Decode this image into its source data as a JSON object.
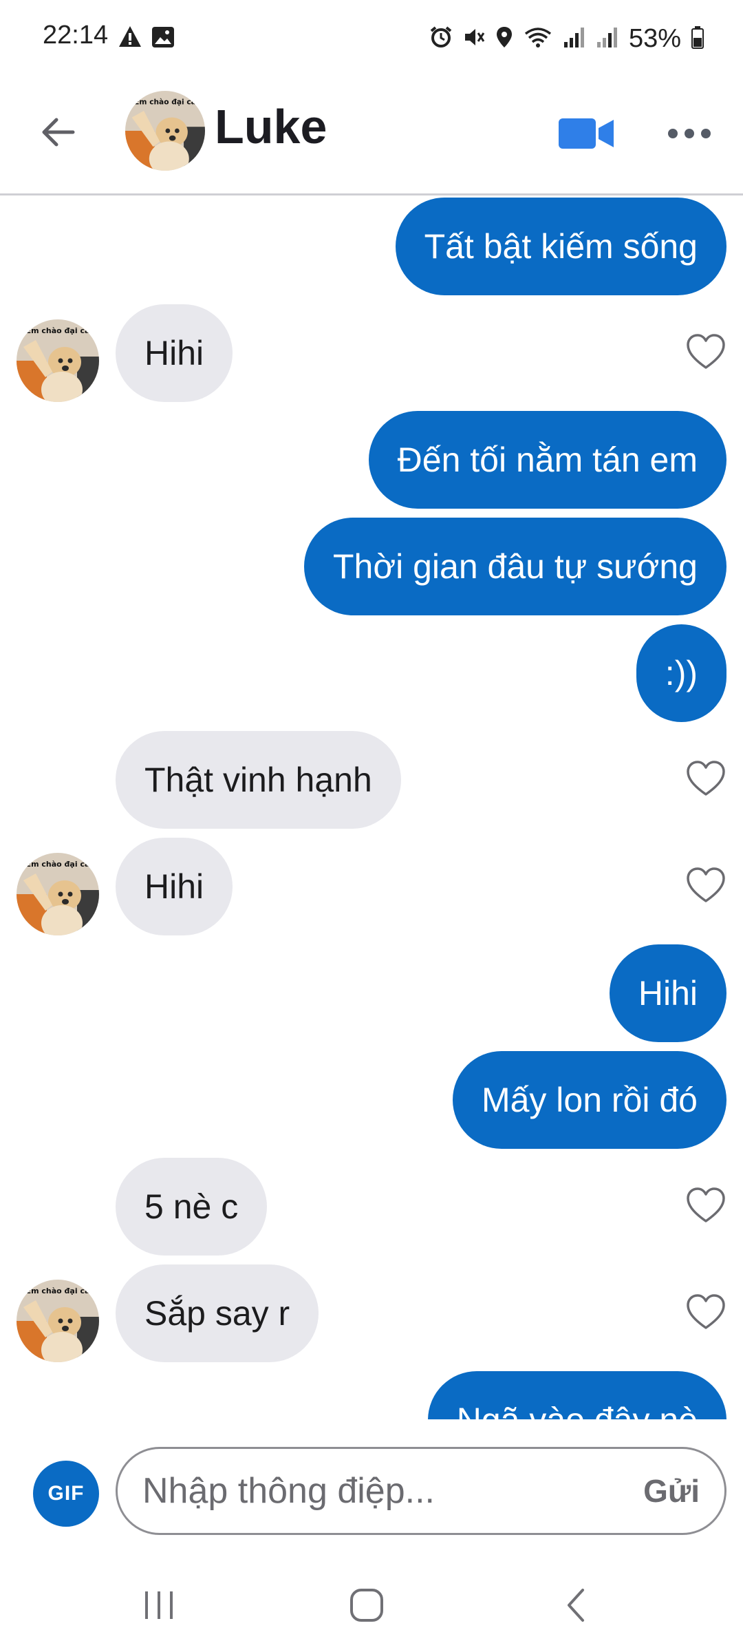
{
  "status_bar": {
    "time": "22:14",
    "battery": "53%",
    "icons": [
      "warning-icon",
      "gallery-icon",
      "alarm-icon",
      "mute-icon",
      "location-icon",
      "wifi-icon",
      "signal-icon",
      "signal-icon",
      "battery-icon"
    ]
  },
  "header": {
    "contact_name": "Luke",
    "avatar_caption": "Em chào đại ca",
    "back_icon": "arrow-left-icon",
    "video_icon": "video-camera-icon",
    "more_icon": "more-horizontal-icon"
  },
  "colors": {
    "accent": "#0a6bc4",
    "incoming_bubble": "#e8e8ed",
    "outgoing_text": "#ffffff",
    "incoming_text": "#1c1c1e"
  },
  "messages": [
    {
      "direction": "out",
      "text": "Tất bật kiếm sống"
    },
    {
      "direction": "in",
      "text": "Hihi",
      "avatar": true,
      "heart": true
    },
    {
      "direction": "out",
      "text": "Đến tối nằm tán em"
    },
    {
      "direction": "out",
      "text": "Thời gian đâu tự sướng"
    },
    {
      "direction": "out",
      "text": ":))"
    },
    {
      "direction": "in",
      "text": "Thật vinh hạnh",
      "avatar": false,
      "heart": true
    },
    {
      "direction": "in",
      "text": "Hihi",
      "avatar": true,
      "heart": true
    },
    {
      "direction": "out",
      "text": "Hihi"
    },
    {
      "direction": "out",
      "text": "Mấy lon rồi đó"
    },
    {
      "direction": "in",
      "text": "5 nè c",
      "avatar": false,
      "heart": true
    },
    {
      "direction": "in",
      "text": "Sắp say r",
      "avatar": true,
      "heart": true
    },
    {
      "direction": "out",
      "text": "Ngã vào đây nè"
    }
  ],
  "composer": {
    "gif_label": "GIF",
    "placeholder": "Nhập thông điệp...",
    "send_label": "Gửi"
  },
  "nav_bar": {
    "icons": [
      "recent-apps-icon",
      "home-icon",
      "back-icon"
    ]
  }
}
